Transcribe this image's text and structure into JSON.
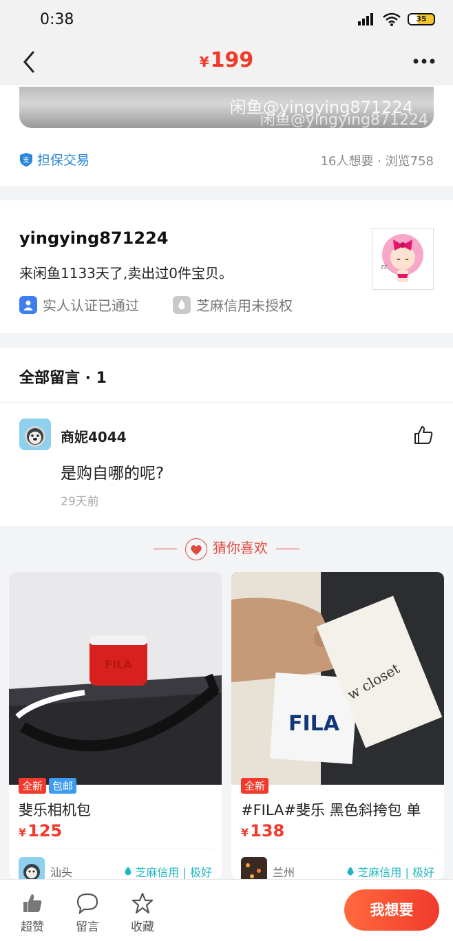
{
  "status_bar": {
    "time": "0:38",
    "battery": "35"
  },
  "nav": {
    "currency": "¥",
    "price": "199"
  },
  "image_watermark": {
    "line1": "闲鱼@yingying871224",
    "line2": "闲鱼@yingying871224"
  },
  "trade": {
    "guarantee": "担保交易",
    "stats": "16人想要 · 浏览758"
  },
  "seller": {
    "username": "yingying871224",
    "description": "来闲鱼1133天了,卖出过0件宝贝。",
    "verified": "实人认证已通过",
    "credit": "芝麻信用未授权"
  },
  "comments": {
    "title": "全部留言 · 1",
    "items": [
      {
        "name": "商妮4044",
        "text": "是购自哪的呢?",
        "time": "29天前"
      }
    ]
  },
  "recommend": {
    "title": "猜你喜欢",
    "products": [
      {
        "tags": [
          "全新",
          "包邮"
        ],
        "title": "斐乐相机包",
        "currency": "¥",
        "price": "125",
        "city": "汕头",
        "credit": "芝麻信用 | 极好",
        "brand_text": "FILA"
      },
      {
        "tags": [
          "全新"
        ],
        "title": "#FILA#斐乐 黑色斜挎包 单",
        "currency": "¥",
        "price": "138",
        "city": "兰州",
        "credit": "芝麻信用 | 极好",
        "brand_text": "FILA",
        "tag_text": "w closet"
      }
    ]
  },
  "bottom_bar": {
    "like": "超赞",
    "comment": "留言",
    "favorite": "收藏",
    "want": "我想要"
  },
  "colors": {
    "accent": "#f23a2c",
    "link": "#2a86d8",
    "credit": "#1fb6c1"
  }
}
